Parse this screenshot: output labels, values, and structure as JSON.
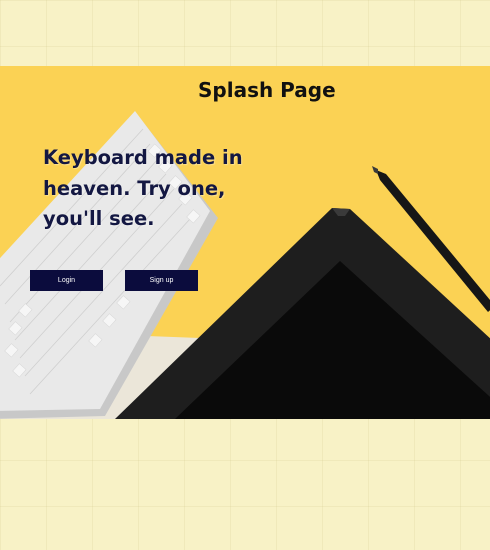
{
  "page": {
    "title": "Splash Page",
    "background_color": "#f8f2c6"
  },
  "hero": {
    "background_color": "#fbd254",
    "headline": "Keyboard made in heaven. Try one, you'll see.",
    "login_label": "Login",
    "signup_label": "Sign up",
    "button_color": "#0b0c3d",
    "headline_color": "#131742"
  }
}
